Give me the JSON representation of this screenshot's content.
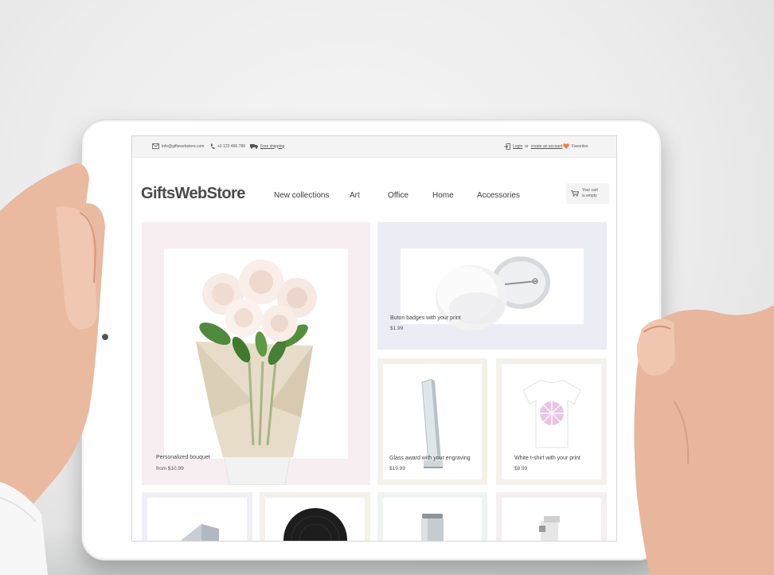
{
  "topbar": {
    "email": "info@giftswebstore.com",
    "phone": "+0 123 456 789",
    "shipping": "Free shipping",
    "login": "Login",
    "or": "or",
    "create_account": "create an account",
    "favorites": "Favorites"
  },
  "header": {
    "logo": "GiftsWebStore",
    "nav": [
      "New collections",
      "Art",
      "Office",
      "Home",
      "Accessories"
    ],
    "cart_line1": "Your cart",
    "cart_line2": "is empty"
  },
  "products": [
    {
      "name": "Personalized bouquet",
      "price": "from $10.99"
    },
    {
      "name": "Buton badges with your print",
      "price": "$1.99"
    },
    {
      "name": "Glass award with your engraving",
      "price": "$19.99"
    },
    {
      "name": "White t-shirt with your print",
      "price": "$9.99"
    }
  ],
  "icons": [
    "mail-icon",
    "phone-icon",
    "truck-icon",
    "login-icon",
    "heart-icon",
    "cart-icon"
  ],
  "colors": {
    "accent_heart": "#f07a4a",
    "tile_pink": "#f6eef0",
    "tile_blue": "#ebedf5",
    "tile_beige": "#f4f1ea",
    "tile_lavender": "#f1eff6",
    "tile_mint": "#eef4f2"
  }
}
